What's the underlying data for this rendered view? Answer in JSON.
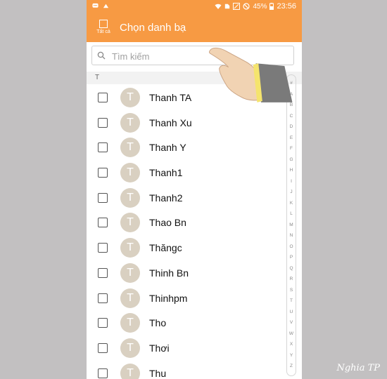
{
  "status_bar": {
    "battery": "45%",
    "time": "23:56",
    "left_icons": [
      "messages-icon",
      "notification-icon"
    ],
    "right_icons": [
      "wifi-icon",
      "sim-icon",
      "signal-icon",
      "no-disturb-icon",
      "battery-icon"
    ]
  },
  "header": {
    "select_all_label": "Tất cả",
    "title": "Chọn danh bạ"
  },
  "search": {
    "placeholder": "Tìm kiếm"
  },
  "section_header": "T",
  "contacts": [
    {
      "initial": "T",
      "name": "Thanh TA"
    },
    {
      "initial": "T",
      "name": "Thanh Xu"
    },
    {
      "initial": "T",
      "name": "Thanh Y"
    },
    {
      "initial": "T",
      "name": "Thanh1"
    },
    {
      "initial": "T",
      "name": "Thanh2"
    },
    {
      "initial": "T",
      "name": "Thao Bn"
    },
    {
      "initial": "T",
      "name": "Thăngc"
    },
    {
      "initial": "T",
      "name": "Thinh Bn"
    },
    {
      "initial": "T",
      "name": "Thinhpm"
    },
    {
      "initial": "T",
      "name": "Tho"
    },
    {
      "initial": "T",
      "name": "Thơi"
    },
    {
      "initial": "T",
      "name": "Thu"
    }
  ],
  "index_letters": [
    "#",
    "A",
    "B",
    "C",
    "D",
    "E",
    "F",
    "G",
    "H",
    "I",
    "J",
    "K",
    "L",
    "M",
    "N",
    "O",
    "P",
    "Q",
    "R",
    "S",
    "T",
    "U",
    "V",
    "W",
    "X",
    "Y",
    "Z"
  ],
  "watermark": "Nghia TP",
  "colors": {
    "accent": "#f79a43",
    "avatar": "#d9d0c1",
    "background": "#c2c0c1"
  }
}
